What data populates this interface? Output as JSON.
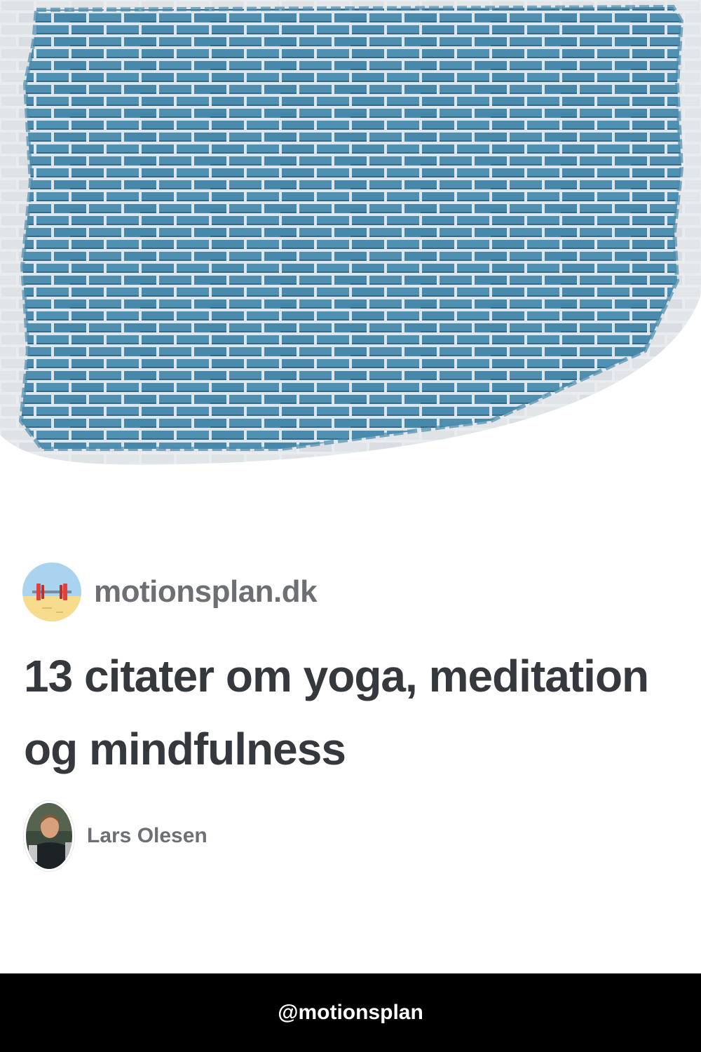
{
  "hero": {
    "image_icon": "brick-wall-image",
    "wall_color": "#4a8bad",
    "paint_edge_color": "#e9ecef"
  },
  "brand": {
    "logo_icon": "barbell-beach-logo",
    "name": "motionsplan.dk"
  },
  "article": {
    "title": "13 citater om yoga, meditation og mindfulness"
  },
  "author": {
    "avatar_icon": "author-photo",
    "name": "Lars Olesen"
  },
  "footer": {
    "handle": "@motionsplan"
  },
  "colors": {
    "text_dark": "#35383c",
    "text_muted": "#6c6f73",
    "footer_bg": "#000000"
  }
}
